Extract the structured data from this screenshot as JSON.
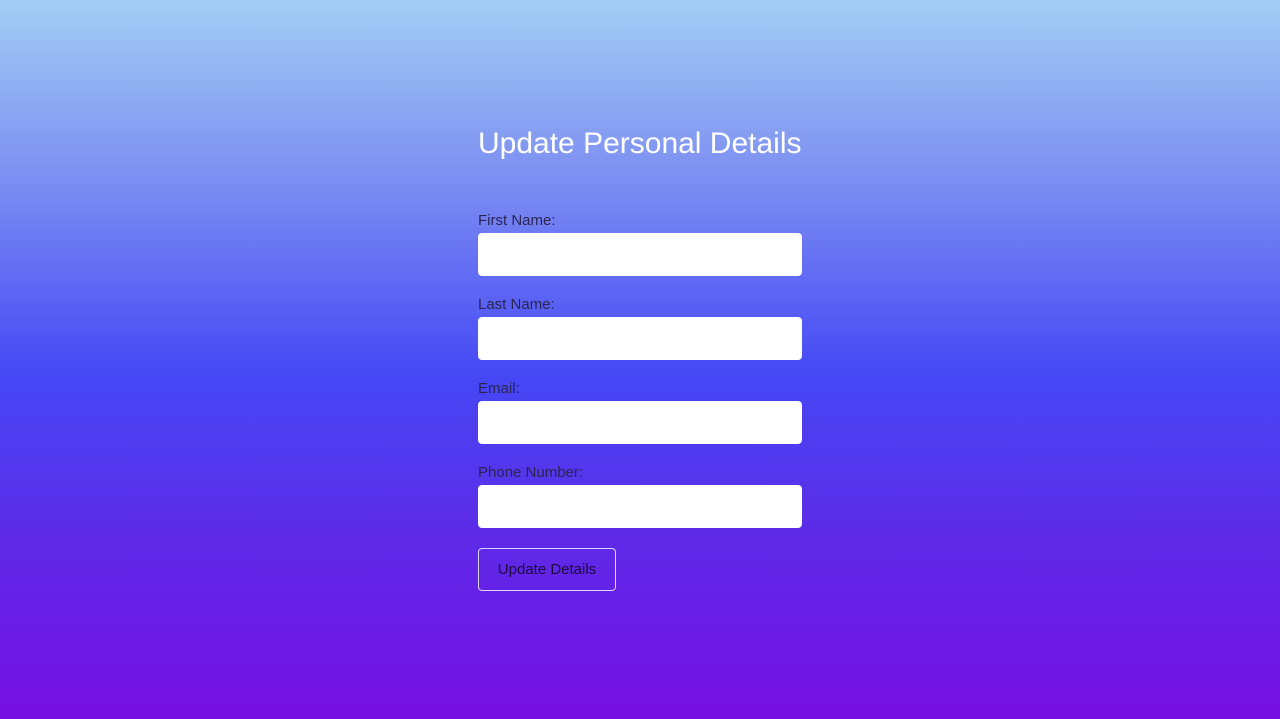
{
  "form": {
    "title": "Update Personal Details",
    "fields": [
      {
        "label": "First Name:",
        "value": "",
        "placeholder": ""
      },
      {
        "label": "Last Name:",
        "value": "",
        "placeholder": ""
      },
      {
        "label": "Email:",
        "value": "",
        "placeholder": ""
      },
      {
        "label": "Phone Number:",
        "value": "",
        "placeholder": ""
      }
    ],
    "submit_label": "Update Details"
  },
  "colors": {
    "gradient_top": "#a3cdf4",
    "gradient_middle": "#4548f5",
    "gradient_bottom": "#760fe2",
    "title_text": "#ffffff",
    "label_text": "#2b2450",
    "input_background": "#ffffff"
  }
}
